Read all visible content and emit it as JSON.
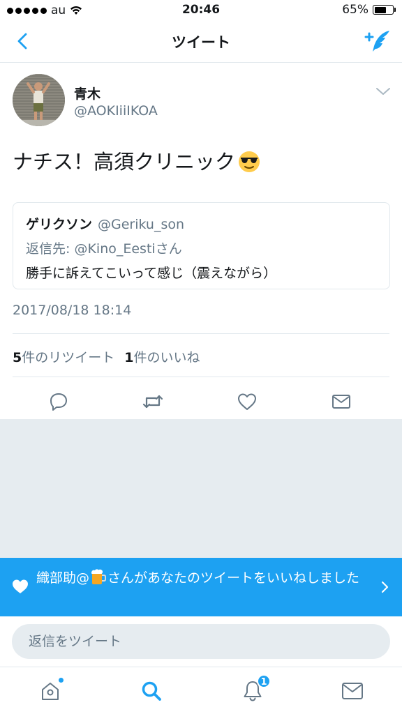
{
  "status_bar": {
    "carrier": "au",
    "time": "20:46",
    "battery": "65%",
    "battery_level": 0.65
  },
  "nav": {
    "title": "ツイート"
  },
  "tweet": {
    "name": "青木",
    "handle": "@AOKIiiIKOA",
    "text": "ナチス！高須クリニック",
    "emoji": "smiling-face-with-sunglasses",
    "quote": {
      "name": "ゲリクソン",
      "handle": "@Geriku_son",
      "reply_prefix": "返信先:",
      "reply_to": "@Kino_Eesti",
      "reply_suffix": "さん",
      "text": "勝手に訴えてこいって感じ（震えながら）"
    },
    "timestamp": "2017/08/18 18:14",
    "retweet_count": "5",
    "retweet_label": "件のリツイート",
    "like_count": "1",
    "like_label": "件のいいね"
  },
  "notification": {
    "name_prefix": "織部助@",
    "message": "さんがあなたのツイートをいいねしました"
  },
  "reply": {
    "placeholder": "返信をツイート"
  },
  "tabbar": {
    "notifications_badge": "1"
  },
  "colors": {
    "accent": "#1da1f2",
    "secondary_text": "#657786",
    "divider": "#e1e8ed",
    "background_gray": "#e6ecf0"
  }
}
